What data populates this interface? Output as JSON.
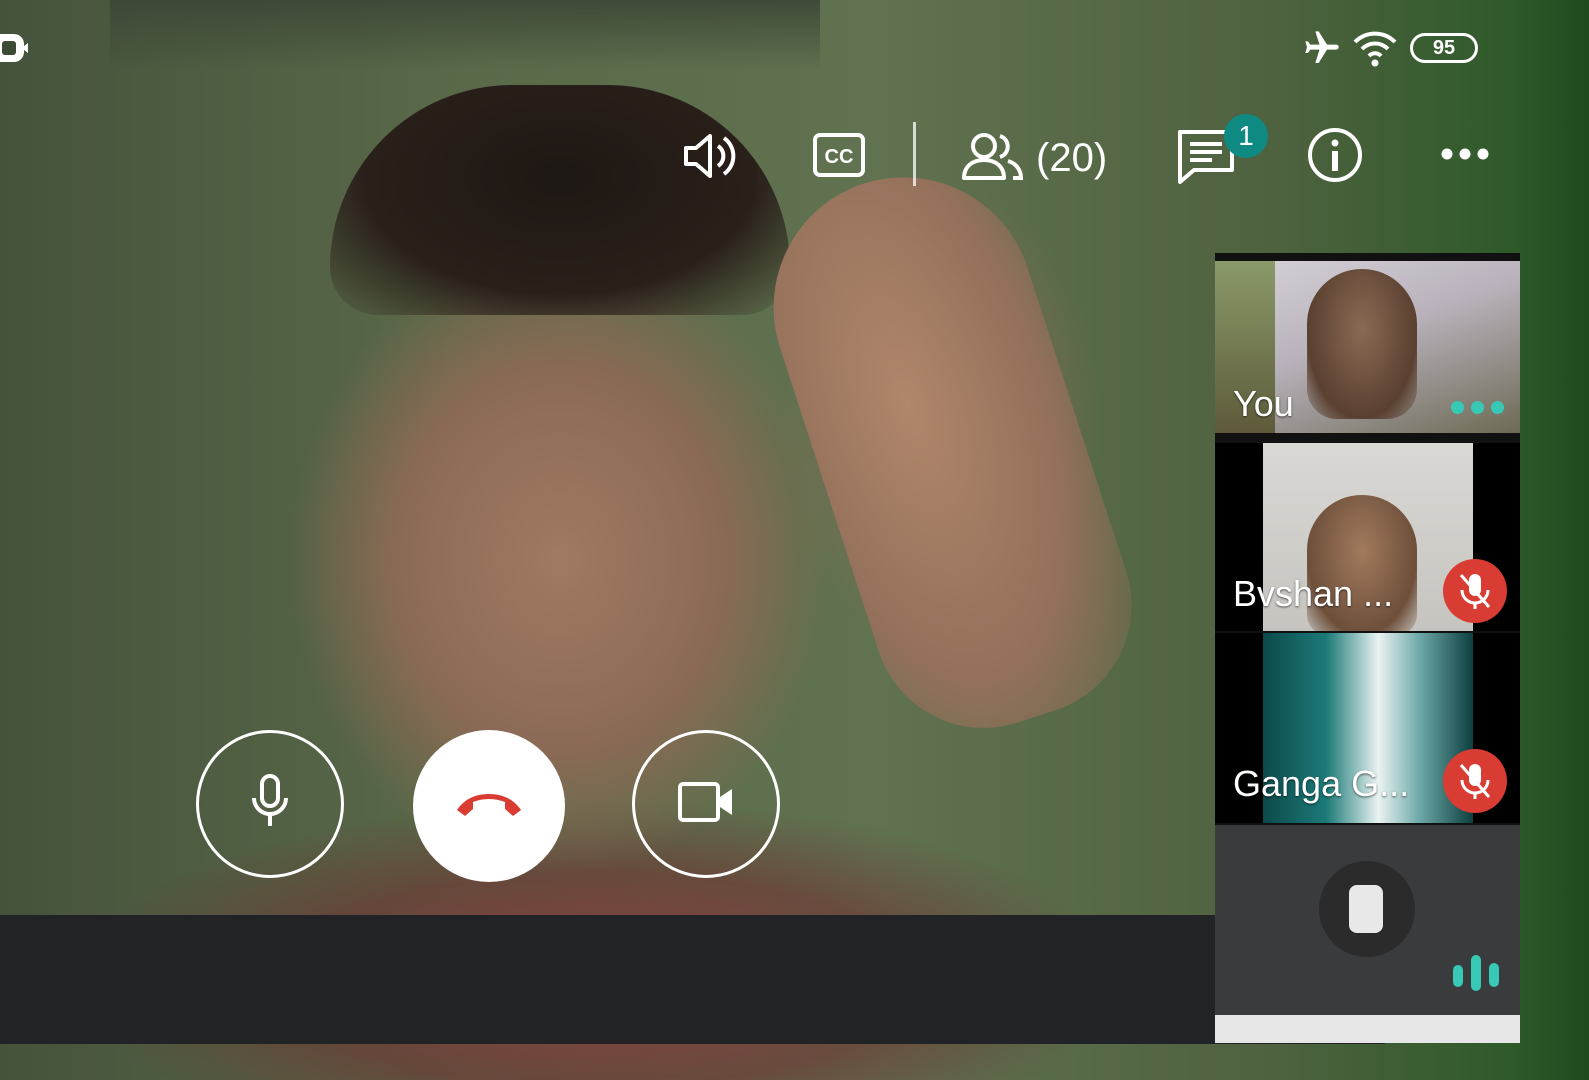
{
  "status_bar": {
    "battery_level": "95",
    "icons": [
      "meet-notification-icon",
      "airplane-icon",
      "wifi-icon",
      "battery-icon"
    ]
  },
  "toolbar": {
    "icons": [
      "speaker-icon",
      "captions-icon",
      "people-icon",
      "chat-icon",
      "info-icon",
      "more-icon"
    ],
    "participants_count": "(20)",
    "chat_badge": "1"
  },
  "controls": {
    "icons": [
      "microphone-icon",
      "end-call-icon",
      "camera-icon"
    ],
    "end_call_color": "#d93c33"
  },
  "participants": [
    {
      "name": "You",
      "state": "speaking",
      "indicator": "dots"
    },
    {
      "name": "Bvshan ...",
      "state": "muted"
    },
    {
      "name": "Ganga G...",
      "state": "muted"
    },
    {
      "name": "",
      "state": "speaking",
      "indicator": "audio-bars"
    }
  ],
  "colors": {
    "accent": "#0f8a83",
    "mute": "#d93c33",
    "speaking": "#38c9b6"
  }
}
